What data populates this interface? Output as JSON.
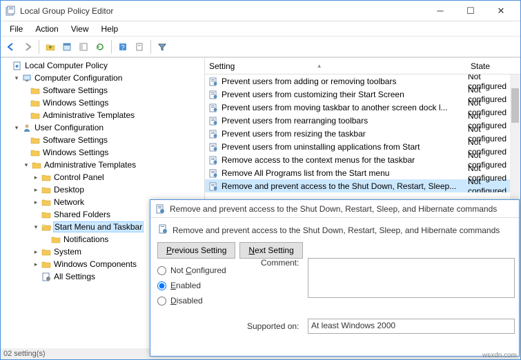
{
  "window": {
    "title": "Local Group Policy Editor"
  },
  "menubar": [
    "File",
    "Action",
    "View",
    "Help"
  ],
  "tree": {
    "root": "Local Computer Policy",
    "cc": "Computer Configuration",
    "ss1": "Software Settings",
    "ws1": "Windows Settings",
    "at1": "Administrative Templates",
    "uc": "User Configuration",
    "ss2": "Software Settings",
    "ws2": "Windows Settings",
    "at2": "Administrative Templates",
    "cp": "Control Panel",
    "dk": "Desktop",
    "nw": "Network",
    "sf": "Shared Folders",
    "smt": "Start Menu and Taskbar",
    "ntf": "Notifications",
    "sys": "System",
    "wc": "Windows Components",
    "as": "All Settings"
  },
  "list": {
    "header_setting": "Setting",
    "header_state": "State",
    "rows": [
      {
        "name": "Prevent users from adding or removing toolbars",
        "state": "Not configured"
      },
      {
        "name": "Prevent users from customizing their Start Screen",
        "state": "Not configured"
      },
      {
        "name": "Prevent users from moving taskbar to another screen dock l...",
        "state": "Not configured"
      },
      {
        "name": "Prevent users from rearranging toolbars",
        "state": "Not configured"
      },
      {
        "name": "Prevent users from resizing the taskbar",
        "state": "Not configured"
      },
      {
        "name": "Prevent users from uninstalling applications from Start",
        "state": "Not configured"
      },
      {
        "name": "Remove access to the context menus for the taskbar",
        "state": "Not configured"
      },
      {
        "name": "Remove All Programs list from the Start menu",
        "state": "Not configured"
      },
      {
        "name": "Remove and prevent access to the Shut Down, Restart, Sleep...",
        "state": "Not configured"
      }
    ],
    "selected_index": 8
  },
  "dialog": {
    "title": "Remove and prevent access to the Shut Down, Restart, Sleep, and Hibernate commands",
    "heading": "Remove and prevent access to the Shut Down, Restart, Sleep, and Hibernate commands",
    "prev_btn": "Previous Setting",
    "next_btn": "Next Setting",
    "radio_notconf": "Not Configured",
    "radio_enabled": "Enabled",
    "radio_disabled": "Disabled",
    "selected_radio": "enabled",
    "comment_label": "Comment:",
    "supported_label": "Supported on:",
    "supported_value": "At least Windows 2000"
  },
  "statusbar": "02 setting(s)",
  "watermark": "wsxdn.com"
}
